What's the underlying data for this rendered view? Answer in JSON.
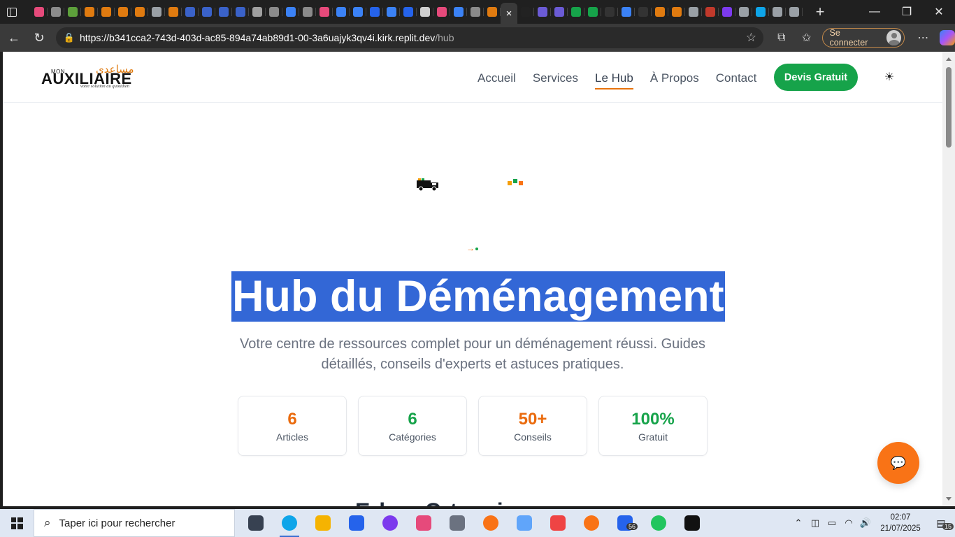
{
  "browser": {
    "url_host": "https://b341cca2-743d-403d-ac85-894a74ab89d1-00-3a6uajyk3qv4i.kirk.replit.dev",
    "url_path": "/hub",
    "signin_label": "Se connecter",
    "tab_close": "×",
    "newtab": "+"
  },
  "site": {
    "logo": {
      "mon": "MON",
      "brand": "AUXILIAIRE",
      "arabic": "مساعدي",
      "tagline": "votre solution au quotidien"
    },
    "nav": [
      "Accueil",
      "Services",
      "Le Hub",
      "À Propos",
      "Contact"
    ],
    "active_nav": "Le Hub",
    "cta": "Devis Gratuit",
    "hero": {
      "title": "Hub du Déménagement",
      "subtitle": "Votre centre de ressources complet pour un déménagement réussi. Guides détaillés, conseils d'experts et astuces pratiques."
    },
    "stats": [
      {
        "value": "6",
        "label": "Articles",
        "color": "#ea6a0c"
      },
      {
        "value": "6",
        "label": "Catégories",
        "color": "#16a34a"
      },
      {
        "value": "50+",
        "label": "Conseils",
        "color": "#ea6a0c"
      },
      {
        "value": "100%",
        "label": "Gratuit",
        "color": "#16a34a"
      }
    ],
    "next_heading_partial": "E l ... C t ... i"
  },
  "taskbar": {
    "search_placeholder": "Taper ici pour rechercher",
    "time": "02:07",
    "date": "21/07/2025",
    "notifications": "15",
    "app_badge": "56"
  },
  "colors": {
    "accent_orange": "#f97316",
    "accent_green": "#16a34a",
    "selection": "#3367d6"
  }
}
